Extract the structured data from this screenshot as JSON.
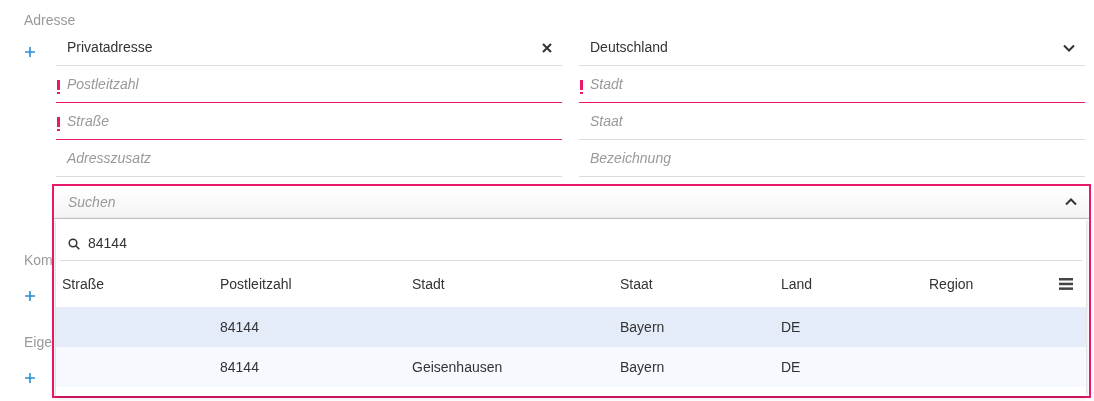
{
  "sections": [
    {
      "label": "Adresse"
    },
    {
      "label": "Kom"
    },
    {
      "label": "Eige"
    }
  ],
  "address_fields": {
    "left": [
      {
        "kind": "select",
        "value": "Privatadresse",
        "clearable": true,
        "required": false,
        "error": false
      },
      {
        "kind": "text",
        "placeholder": "Postleitzahl",
        "required": true,
        "error": true
      },
      {
        "kind": "text",
        "placeholder": "Straße",
        "required": true,
        "error": true
      },
      {
        "kind": "text",
        "placeholder": "Adresszusatz",
        "required": false,
        "error": false
      }
    ],
    "right": [
      {
        "kind": "select",
        "value": "Deutschland",
        "clearable": false,
        "required": false,
        "error": false
      },
      {
        "kind": "text",
        "placeholder": "Stadt",
        "required": true,
        "error": true
      },
      {
        "kind": "text",
        "placeholder": "Staat",
        "required": false,
        "error": false
      },
      {
        "kind": "text",
        "placeholder": "Bezeichnung",
        "required": false,
        "error": false
      }
    ]
  },
  "lookup": {
    "placeholder": "Suchen",
    "expanded": true,
    "search_value": "84144",
    "columns": [
      "Straße",
      "Postleitzahl",
      "Stadt",
      "Staat",
      "Land",
      "Region"
    ],
    "rows": [
      {
        "cells": [
          "",
          "84144",
          "",
          "Bayern",
          "DE",
          ""
        ],
        "selected": true
      },
      {
        "cells": [
          "",
          "84144",
          "Geisenhausen",
          "Bayern",
          "DE",
          ""
        ],
        "selected": false
      }
    ]
  }
}
